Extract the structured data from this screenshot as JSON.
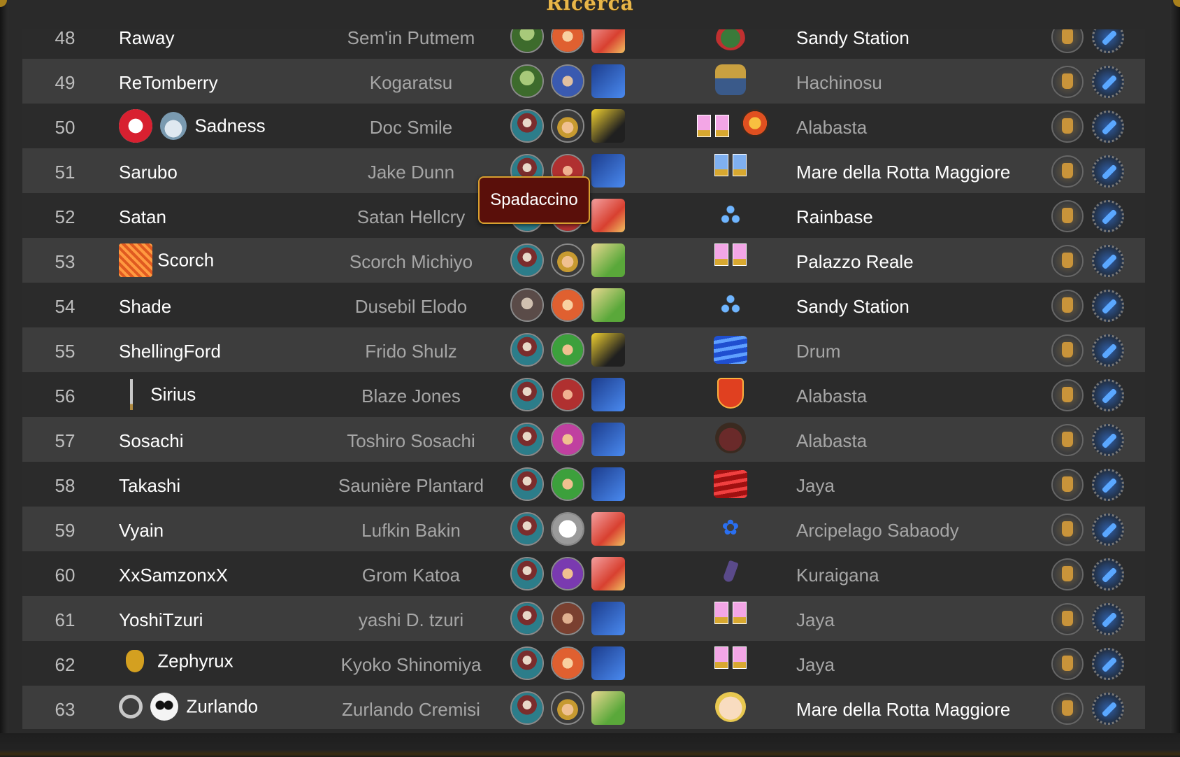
{
  "window": {
    "title": "Ricerca"
  },
  "tooltip": {
    "text": "Spadaccino"
  },
  "rows": [
    {
      "num": "48",
      "player": "Raway",
      "character": "Sem'in Putmem",
      "location": "Sandy Station"
    },
    {
      "num": "49",
      "player": "ReTomberry",
      "character": "Kogaratsu",
      "location": "Hachinosu"
    },
    {
      "num": "50",
      "player": "Sadness",
      "character": "Doc Smile",
      "location": "Alabasta"
    },
    {
      "num": "51",
      "player": "Sarubo",
      "character": "Jake Dunn",
      "location": "Mare della Rotta Maggiore"
    },
    {
      "num": "52",
      "player": "Satan",
      "character": "Satan Hellcry",
      "location": "Rainbase"
    },
    {
      "num": "53",
      "player": "Scorch",
      "character": "Scorch Michiyo",
      "location": "Palazzo Reale"
    },
    {
      "num": "54",
      "player": "Shade",
      "character": "Dusebil Elodo",
      "location": "Sandy Station"
    },
    {
      "num": "55",
      "player": "ShellingFord",
      "character": "Frido Shulz",
      "location": "Drum"
    },
    {
      "num": "56",
      "player": "Sirius",
      "character": "Blaze Jones",
      "location": "Alabasta"
    },
    {
      "num": "57",
      "player": "Sosachi",
      "character": "Toshiro Sosachi",
      "location": "Alabasta"
    },
    {
      "num": "58",
      "player": "Takashi",
      "character": "Saunière Plantard",
      "location": "Jaya"
    },
    {
      "num": "59",
      "player": "Vyain",
      "character": "Lufkin Bakin",
      "location": "Arcipelago Sabaody"
    },
    {
      "num": "60",
      "player": "XxSamzonxX",
      "character": "Grom Katoa",
      "location": "Kuraigana"
    },
    {
      "num": "61",
      "player": "YoshiTzuri",
      "character": "yashi D. tzuri",
      "location": "Jaya"
    },
    {
      "num": "62",
      "player": "Zephyrux",
      "character": "Kyoko Shinomiya",
      "location": "Jaya"
    },
    {
      "num": "63",
      "player": "Zurlando",
      "character": "Zurlando Cremisi",
      "location": "Mare della Rotta Maggiore"
    }
  ],
  "icons": {
    "profile_action": "profile-icon",
    "settings_action": "gear-icon"
  },
  "colors": {
    "title": "#e8b64a",
    "row_dark": "#2b2b2b",
    "row_light": "#3d3d3d",
    "tooltip_bg": "#5a0f0a",
    "tooltip_border": "#d8a030"
  }
}
